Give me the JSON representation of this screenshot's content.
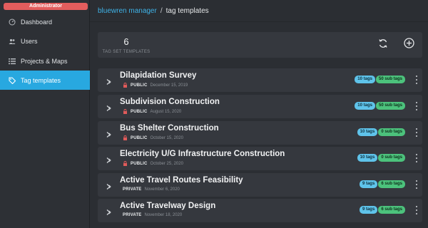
{
  "sidebar": {
    "role": "Administrator",
    "items": [
      {
        "label": "Dashboard",
        "icon": "gauge-icon"
      },
      {
        "label": "Users",
        "icon": "users-icon"
      },
      {
        "label": "Projects & Maps",
        "icon": "list-icon"
      },
      {
        "label": "Tag templates",
        "icon": "tag-icon",
        "active": true
      }
    ]
  },
  "breadcrumb": {
    "root": "bluewren manager",
    "separator": "/",
    "current": "tag templates"
  },
  "summary": {
    "count": "6",
    "label": "TAG SET TEMPLATES"
  },
  "templates": [
    {
      "title": "Dilapidation Survey",
      "visibility": "PUBLIC",
      "date": "December 15, 2019",
      "tags": "10 tags",
      "subtags": "50 sub tags"
    },
    {
      "title": "Subdivision Construction",
      "visibility": "PUBLIC",
      "date": "August 15, 2020",
      "tags": "10 tags",
      "subtags": "50 sub tags"
    },
    {
      "title": "Bus Shelter Construction",
      "visibility": "PUBLIC",
      "date": "October 15, 2020",
      "tags": "10 tags",
      "subtags": "0 sub tags"
    },
    {
      "title": "Electricity U/G Infrastructure Construction",
      "visibility": "PUBLIC",
      "date": "October 25, 2020",
      "tags": "10 tags",
      "subtags": "0 sub tags"
    },
    {
      "title": "Active Travel Routes Feasibility",
      "visibility": "PRIVATE",
      "date": "November 6, 2020",
      "tags": "9 tags",
      "subtags": "6 sub tags"
    },
    {
      "title": "Active Travelway Design",
      "visibility": "PRIVATE",
      "date": "November 18, 2020",
      "tags": "9 tags",
      "subtags": "6 sub tags"
    }
  ],
  "colors": {
    "accent": "#28a8e0",
    "role_badge": "#e35d5d",
    "tags_badge": "#5fc3ea",
    "subtags_badge": "#4cc27c",
    "lock": "#e05a5a"
  }
}
